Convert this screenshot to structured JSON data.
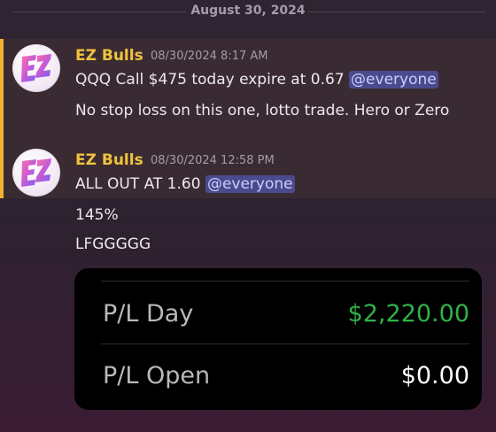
{
  "date_divider": "August 30, 2024",
  "colors": {
    "author": "#f0c33d",
    "mention_bg": "#4b4a8c",
    "pl_positive": "#2fb24a",
    "highlight_bar": "#f0b232"
  },
  "messages": [
    {
      "avatar": "ez-bulls-avatar",
      "author": "EZ Bulls",
      "timestamp": "08/30/2024 8:17 AM",
      "line1_text": "QQQ Call $475 today expire at 0.67 ",
      "line1_mention": "@everyone",
      "line2": "No stop loss on this one, lotto trade. Hero or Zero"
    },
    {
      "avatar": "ez-bulls-avatar",
      "author": "EZ Bulls",
      "timestamp": "08/30/2024 12:58 PM",
      "line1_text": "ALL OUT AT 1.60 ",
      "line1_mention": "@everyone",
      "line2": "145%",
      "line3": "LFGGGGG"
    }
  ],
  "attachment": {
    "rows": [
      {
        "label": "P/L Day",
        "value": "$2,220.00"
      },
      {
        "label": "P/L Open",
        "value": "$0.00"
      }
    ]
  }
}
